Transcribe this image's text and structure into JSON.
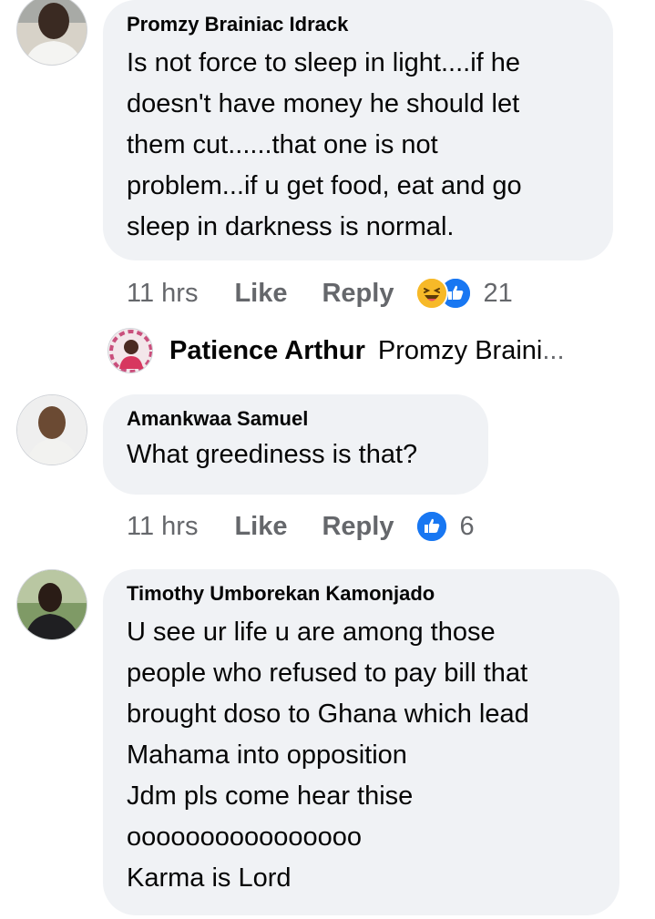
{
  "comments": [
    {
      "author": "Promzy Brainiac Idrack",
      "lines": [
        "Is not force to sleep in light....if he",
        "doesn't have money he should let",
        "them cut......that one is not",
        "problem...if u get food, eat and go",
        "sleep in darkness is normal."
      ],
      "time": "11 hrs",
      "like_label": "Like",
      "reply_label": "Reply",
      "reaction_icons": [
        "haha-icon",
        "like-icon"
      ],
      "reaction_count": "21"
    },
    {
      "author": "Amankwaa Samuel",
      "lines": [
        "What greediness is that?"
      ],
      "time": "11 hrs",
      "like_label": "Like",
      "reply_label": "Reply",
      "reaction_icons": [
        "like-icon"
      ],
      "reaction_count": "6"
    },
    {
      "author": "Timothy Umborekan Kamonjado",
      "lines": [
        "U see ur life u are among those",
        "people who refused to pay bill that",
        "brought doso to Ghana which lead",
        "Mahama into opposition",
        "Jdm pls come hear thise",
        "oooooooooooooooo",
        "Karma is Lord"
      ]
    }
  ],
  "reply_preview": {
    "author": "Patience Arthur",
    "snippet": "Promzy Braini",
    "ellipsis": "..."
  },
  "colors": {
    "bubble": "#f0f2f5",
    "meta_text": "#65676b",
    "like_blue": "#1877f2",
    "haha_yellow": "#f7b928"
  }
}
